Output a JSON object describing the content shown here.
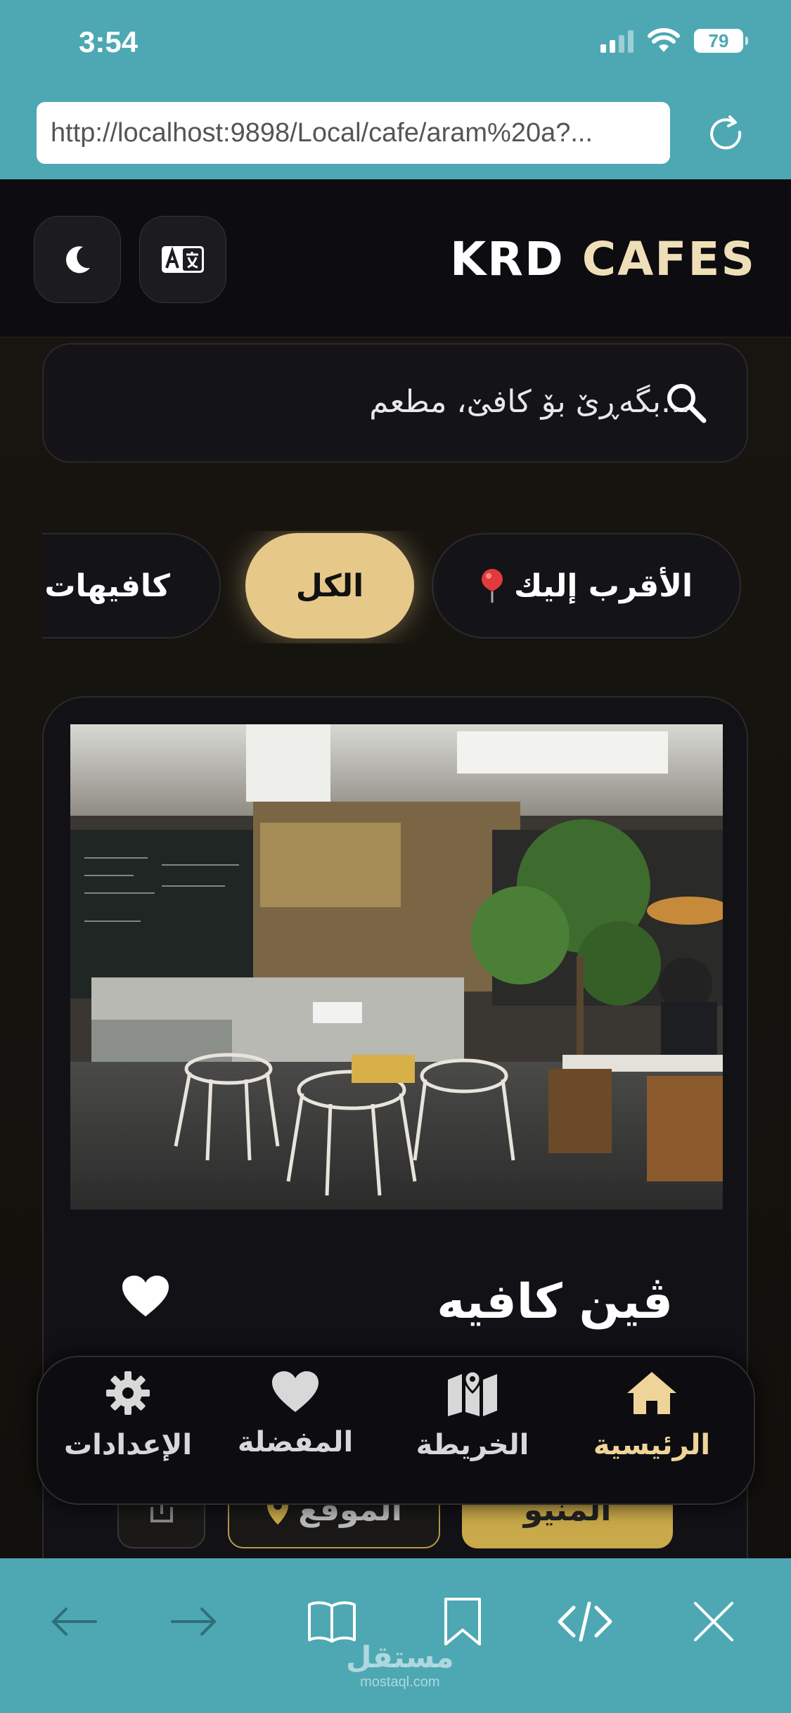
{
  "status_bar": {
    "time": "3:54",
    "battery": "79"
  },
  "browser": {
    "url": "http://localhost:9898/Local/cafe/aram%20a?..."
  },
  "header": {
    "brand_part1": "KRD",
    "brand_part2": "CAFES"
  },
  "search": {
    "placeholder": "...بگەڕێ بۆ کافێ، مطعم"
  },
  "filters": [
    {
      "label": "الأقرب إليك",
      "icon": "pin-icon"
    },
    {
      "label": "الكل",
      "active": true
    },
    {
      "label": "كافيهات"
    }
  ],
  "card": {
    "title": "ڤين كافيه",
    "menu_label": "المنيو",
    "location_label": "الموقع"
  },
  "nav": {
    "home": "الرئيسية",
    "map": "الخريطة",
    "favorites": "المفضلة",
    "settings": "الإعدادات"
  },
  "watermark": {
    "ar": "مستقل",
    "en": "mostaql.com"
  },
  "colors": {
    "accent": "#e6c989",
    "browser_chrome": "#4da8b3",
    "background": "#0f0e0c"
  }
}
